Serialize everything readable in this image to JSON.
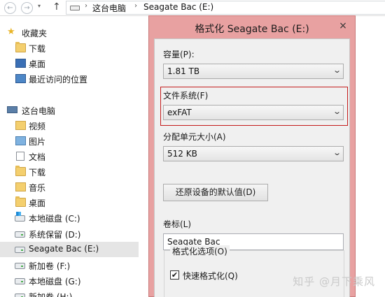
{
  "address_bar": {
    "back_glyph": "←",
    "forward_glyph": "→",
    "up_glyph": "↑",
    "breadcrumb": [
      "这台电脑",
      "Seagate Bac (E:)"
    ],
    "separator": "›"
  },
  "nav": {
    "items": [
      {
        "label": "收藏夹",
        "icon": "star-icon"
      },
      {
        "label": "下载",
        "icon": "downloads-folder-icon"
      },
      {
        "label": "桌面",
        "icon": "desktop-icon"
      },
      {
        "label": "最近访问的位置",
        "icon": "recent-places-icon"
      },
      {
        "label": "这台电脑",
        "icon": "computer-icon"
      },
      {
        "label": "视频",
        "icon": "videos-folder-icon"
      },
      {
        "label": "图片",
        "icon": "pictures-folder-icon"
      },
      {
        "label": "文档",
        "icon": "documents-folder-icon"
      },
      {
        "label": "下载",
        "icon": "downloads-folder-icon"
      },
      {
        "label": "音乐",
        "icon": "music-folder-icon"
      },
      {
        "label": "桌面",
        "icon": "desktop-folder-icon"
      },
      {
        "label": "本地磁盘 (C:)",
        "icon": "windows-drive-icon"
      },
      {
        "label": "系统保留 (D:)",
        "icon": "drive-icon"
      },
      {
        "label": "Seagate Bac (E:)",
        "icon": "drive-icon"
      },
      {
        "label": "新加卷 (F:)",
        "icon": "drive-icon"
      },
      {
        "label": "本地磁盘 (G:)",
        "icon": "drive-icon"
      },
      {
        "label": "新加卷 (H:)",
        "icon": "drive-icon"
      }
    ],
    "selected": "Seagate Bac (E:)"
  },
  "dialog": {
    "title": "格式化 Seagate Bac (E:)",
    "close_glyph": "×",
    "capacity": {
      "label": "容量(P):",
      "value": "1.81 TB"
    },
    "file_system": {
      "label": "文件系统(F)",
      "value": "exFAT"
    },
    "allocation": {
      "label": "分配单元大小(A)",
      "value": "512 KB"
    },
    "restore_defaults_label": "还原设备的默认值(D)",
    "volume_label": {
      "label": "卷标(L)",
      "value": "Seagate Bac"
    },
    "format_options": {
      "label": "格式化选项(O)",
      "quick_format_label": "快速格式化(Q)",
      "quick_format_checked": true,
      "check_glyph": "✔"
    },
    "highlight_color": "#c41a1a",
    "frame_color": "#e8a1a1"
  },
  "watermark": "知乎 @月下乘风"
}
